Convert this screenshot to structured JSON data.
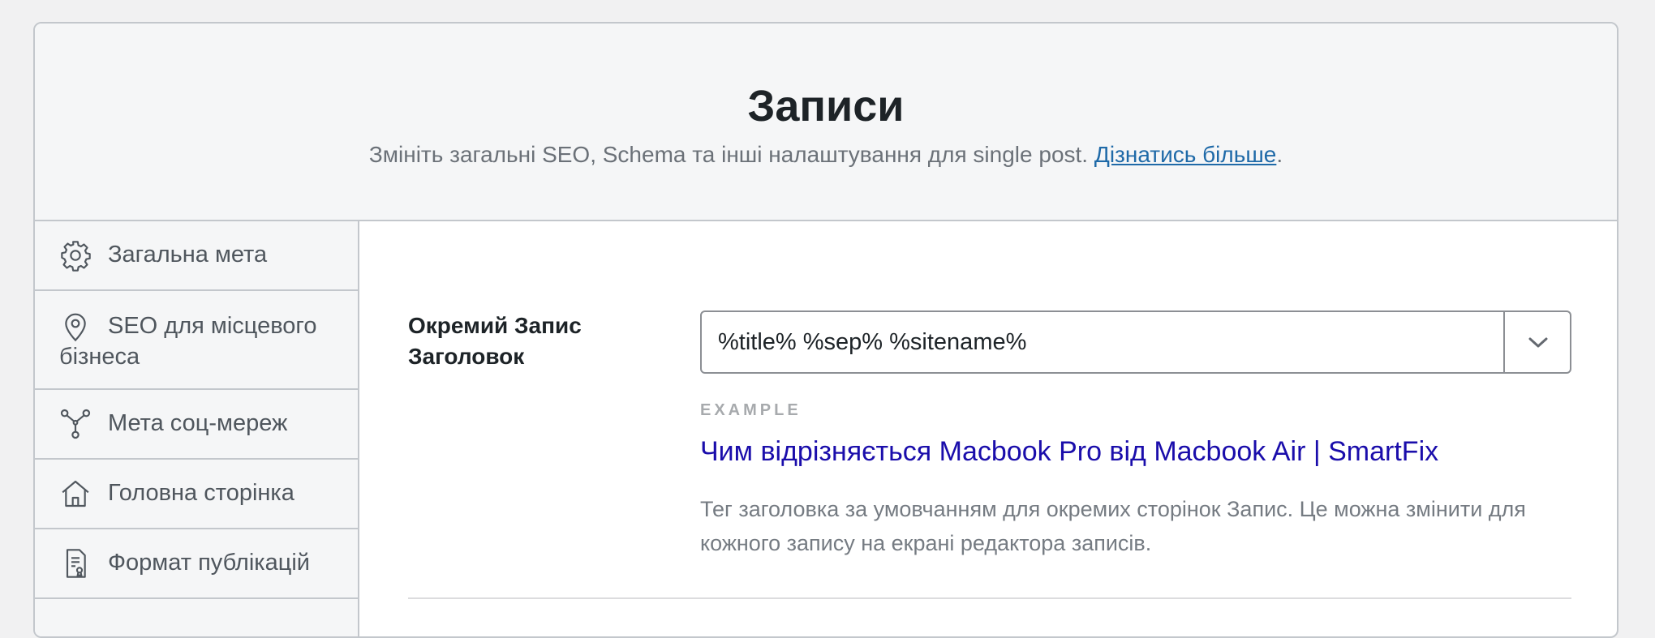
{
  "header": {
    "title": "Записи",
    "description": "Змініть загальні SEO, Schema та інші налаштування для single post.",
    "learn_more_label": "Дізнатись більше",
    "period": "."
  },
  "sidebar": {
    "items": [
      {
        "icon": "gear-icon",
        "label": "Загальна мета"
      },
      {
        "icon": "location-pin-icon",
        "label": "SEO для місцевого бізнеса"
      },
      {
        "icon": "social-share-icon",
        "label": "Мета соц-мереж"
      },
      {
        "icon": "home-icon",
        "label": "Головна сторінка"
      },
      {
        "icon": "document-format-icon",
        "label": "Формат публікацій"
      }
    ]
  },
  "main": {
    "field_label": "Окремий Запис Заголовок",
    "title_template": "%title% %sep% %sitename%",
    "example_caption": "EXAMPLE",
    "example_title": "Чим відрізняється Macbook Pro від Macbook Air | SmartFix",
    "help_text": "Тег заголовка за умовчанням для окремих сторінок Запис. Це можна змінити для кожного запису на екрані редактора записів."
  },
  "colors": {
    "link": "#1f6aa8",
    "example_title": "#1a0dab",
    "border": "#c3c7cc"
  }
}
